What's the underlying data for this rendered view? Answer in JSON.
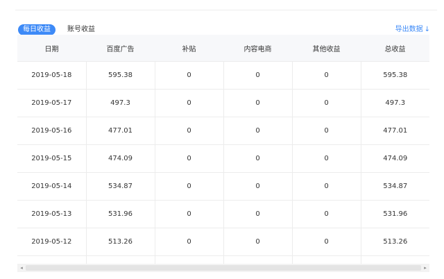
{
  "tabs": [
    {
      "label": "每日收益",
      "active": true
    },
    {
      "label": "账号收益",
      "active": false
    }
  ],
  "export": {
    "label": "导出数据",
    "icon": "download-arrow-icon",
    "arrow_glyph": "↓"
  },
  "table": {
    "columns": [
      "日期",
      "百度广告",
      "补贴",
      "内容电商",
      "其他收益",
      "总收益"
    ],
    "rows": [
      [
        "2019-05-18",
        "595.38",
        "0",
        "0",
        "0",
        "595.38"
      ],
      [
        "2019-05-17",
        "497.3",
        "0",
        "0",
        "0",
        "497.3"
      ],
      [
        "2019-05-16",
        "477.01",
        "0",
        "0",
        "0",
        "477.01"
      ],
      [
        "2019-05-15",
        "474.09",
        "0",
        "0",
        "0",
        "474.09"
      ],
      [
        "2019-05-14",
        "534.87",
        "0",
        "0",
        "0",
        "534.87"
      ],
      [
        "2019-05-13",
        "531.96",
        "0",
        "0",
        "0",
        "531.96"
      ],
      [
        "2019-05-12",
        "513.26",
        "0",
        "0",
        "0",
        "513.26"
      ]
    ]
  },
  "scrollbar": {
    "left_glyph": "◂",
    "right_glyph": "▸"
  },
  "colors": {
    "accent": "#3d8af7",
    "text": "#333333",
    "border": "#ececec",
    "header_bg": "#f7f8fa"
  }
}
